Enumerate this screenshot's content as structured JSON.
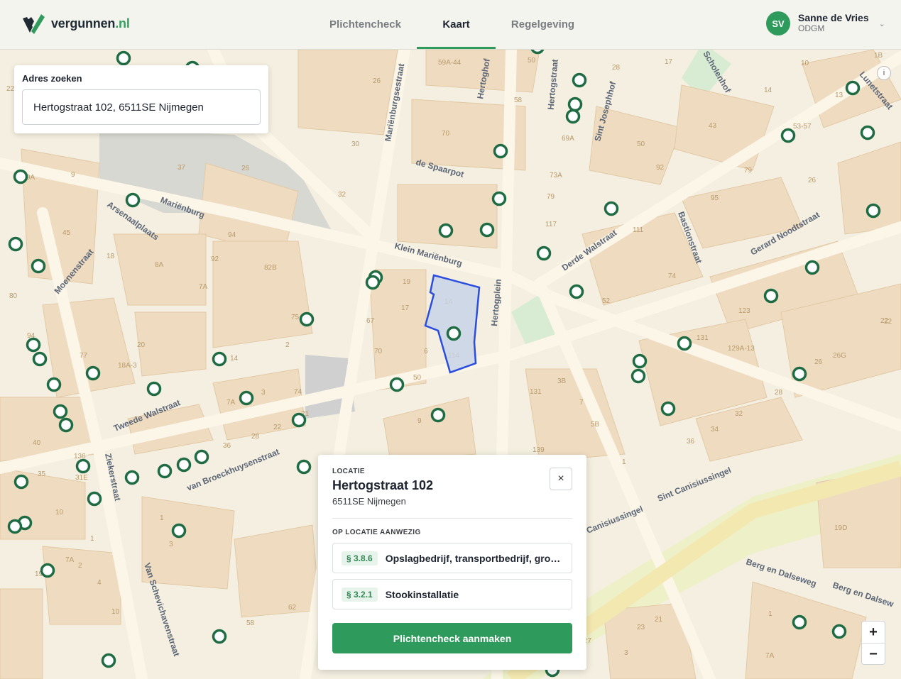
{
  "header": {
    "logo_text": "vergunnen",
    "logo_tld": ".nl",
    "nav": [
      {
        "label": "Plichtencheck",
        "active": false
      },
      {
        "label": "Kaart",
        "active": true
      },
      {
        "label": "Regelgeving",
        "active": false
      }
    ],
    "user": {
      "initials": "SV",
      "name": "Sanne de Vries",
      "org": "ODGM"
    }
  },
  "search": {
    "label": "Adres zoeken",
    "value": "Hertogstraat 102, 6511SE Nijmegen"
  },
  "map": {
    "info_label": "i",
    "colors": {
      "background": "#f4efe0",
      "block": "#efdcc0",
      "marker": "#1f6b44",
      "parcel_stroke": "#2a4de0",
      "parcel_fill": "#c8d3e6"
    },
    "streets": [
      "Hertogstraat",
      "Mariënburgsestraat",
      "Hertoghof",
      "Sint Josephhof",
      "Scholenhof",
      "Mariënburg",
      "de Spaarpot",
      "Klein Mariënburg",
      "Hertogplein",
      "Derde Walstraat",
      "Bastionstraat",
      "Gerard Noodtstraat",
      "Lunetstraat",
      "Arsenaalplaats",
      "Moenenstraat",
      "Tweede Walstraat",
      "van Broeckhuysenstraat",
      "Ziekerstraat",
      "Van Schevichavenstraat",
      "Sint Canisiussingel",
      "Canisiussingel",
      "Berg en Dalseweg",
      "Berg en Dalsew"
    ],
    "house_numbers": [
      "59A-44",
      "50",
      "26",
      "58",
      "70",
      "17",
      "28",
      "10",
      "14",
      "43",
      "50",
      "92",
      "69A",
      "73A",
      "79",
      "117",
      "111",
      "74",
      "53-57",
      "79",
      "26",
      "95",
      "13",
      "1B",
      "22",
      "9A",
      "9",
      "37",
      "26",
      "30",
      "32",
      "45",
      "18",
      "8A",
      "94",
      "92",
      "82B",
      "7A",
      "75",
      "2",
      "19",
      "17",
      "14",
      "67",
      "70",
      "6",
      "114",
      "50",
      "20",
      "18A-3",
      "77",
      "94",
      "14",
      "80",
      "3",
      "74",
      "7A",
      "22",
      "28",
      "21",
      "36",
      "9",
      "3B",
      "7",
      "131",
      "139",
      "5B",
      "1",
      "52",
      "123",
      "131",
      "129A-13",
      "26G",
      "26",
      "28",
      "22",
      "32",
      "34",
      "36",
      "40",
      "136",
      "31E",
      "35",
      "10",
      "1",
      "7A",
      "2",
      "4",
      "19",
      "10",
      "3",
      "1",
      "62",
      "58",
      "19D",
      "1",
      "27",
      "23",
      "21",
      "7A",
      "3",
      "75",
      "22"
    ]
  },
  "popup": {
    "kicker": "LOCATIE",
    "title": "Hertogstraat 102",
    "subtitle": "6511SE Nijmegen",
    "close_label": "×",
    "section_label": "OP LOCATIE AANWEZIG",
    "activities": [
      {
        "code": "§ 3.8.6",
        "name": "Opslagbedrijf, transportbedrijf, groo..."
      },
      {
        "code": "§ 3.2.1",
        "name": "Stookinstallatie"
      }
    ],
    "cta_label": "Plichtencheck aanmaken"
  },
  "zoom": {
    "in_label": "+",
    "out_label": "−"
  }
}
